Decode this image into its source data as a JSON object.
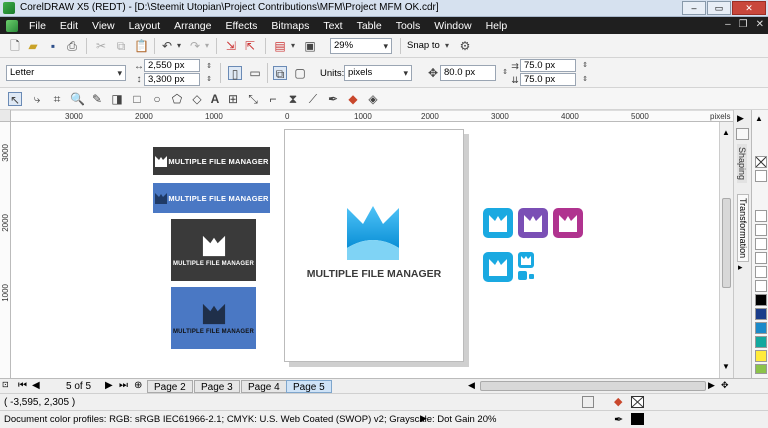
{
  "window": {
    "title": "CorelDRAW X5 (REDT) - [D:\\Steemit Utopian\\Project Contributions\\MFM\\Project MFM OK.cdr]"
  },
  "menu": [
    "File",
    "Edit",
    "View",
    "Layout",
    "Arrange",
    "Effects",
    "Bitmaps",
    "Text",
    "Table",
    "Tools",
    "Window",
    "Help"
  ],
  "toolbar": {
    "zoom": "29%",
    "snap": "Snap to"
  },
  "property_bar": {
    "paper": "Letter",
    "width": "2,550 px",
    "height": "3,300 px",
    "units_label": "Units:",
    "units": "pixels",
    "nudge": "80.0 px",
    "dup_x": "75.0 px",
    "dup_y": "75.0 px"
  },
  "ruler": {
    "h_ticks": [
      "3000",
      "2000",
      "1000",
      "0",
      "1000",
      "2000",
      "3000",
      "4000",
      "5000"
    ],
    "v_ticks": [
      "3000",
      "2000",
      "1000"
    ],
    "unit": "pixels"
  },
  "dockers": [
    "Shaping",
    "Transformation"
  ],
  "logo": {
    "text": "MULTIPLE FILE MANAGER"
  },
  "colors": {
    "dark": "#3a3a3a",
    "blue": "#4a78c4",
    "cyan": "#1aa9e1",
    "purple": "#7a4fb5",
    "magenta": "#b0338f"
  },
  "pages": {
    "counter": "5 of 5",
    "tabs": [
      "Page 2",
      "Page 3",
      "Page 4",
      "Page 5"
    ],
    "active": "Page 5"
  },
  "status": {
    "coords": "( -3,595, 2,305 )",
    "profiles": "Document color profiles: RGB: sRGB IEC61966-2.1; CMYK: U.S. Web Coated (SWOP) v2; Grayscale: Dot Gain 20%"
  },
  "palette": [
    "#ffffff",
    "#000000",
    "#1b3d8a",
    "#1b8ac9",
    "#13a89e",
    "#2e7d32",
    "#43a047",
    "#ffeb3b",
    "#8bc34a"
  ]
}
